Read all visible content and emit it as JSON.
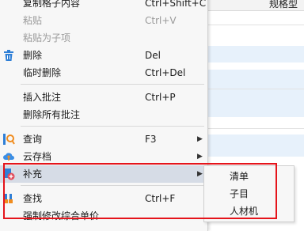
{
  "background": {
    "header_text": "规格型"
  },
  "menu": {
    "items": [
      {
        "label": "复制格子内容",
        "shortcut": "Ctrl+Shift+C",
        "disabled": false
      },
      {
        "label": "粘贴",
        "shortcut": "Ctrl+V",
        "disabled": true
      },
      {
        "label": "粘贴为子项",
        "shortcut": "",
        "disabled": true
      },
      {
        "label": "删除",
        "shortcut": "Del",
        "disabled": false,
        "icon": "trash-icon"
      },
      {
        "label": "临时删除",
        "shortcut": "Ctrl+Del",
        "disabled": false
      },
      {
        "label": "插入批注",
        "shortcut": "Ctrl+P",
        "disabled": false
      },
      {
        "label": "删除所有批注",
        "shortcut": "",
        "disabled": false
      },
      {
        "label": "查询",
        "shortcut": "F3",
        "disabled": false,
        "icon": "query-icon",
        "submenu": true
      },
      {
        "label": "云存档",
        "shortcut": "",
        "disabled": false,
        "icon": "cloud-upload-icon",
        "submenu": true
      },
      {
        "label": "补充",
        "shortcut": "",
        "disabled": false,
        "icon": "supplement-icon",
        "submenu": true,
        "highlighted": true
      },
      {
        "label": "查找",
        "shortcut": "Ctrl+F",
        "disabled": false,
        "icon": "find-icon"
      },
      {
        "label": "强制修改综合单价",
        "shortcut": "",
        "disabled": false
      }
    ]
  },
  "submenu": {
    "items": [
      {
        "label": "清单"
      },
      {
        "label": "子目"
      },
      {
        "label": "人材机"
      }
    ]
  },
  "colors": {
    "highlight_border": "#e5141b",
    "trash_icon": "#2f7fd6",
    "cloud_icon": "#3a8ee6",
    "query_icon_orange": "#f08c1e",
    "supplement_icon": "#e24b5a"
  }
}
